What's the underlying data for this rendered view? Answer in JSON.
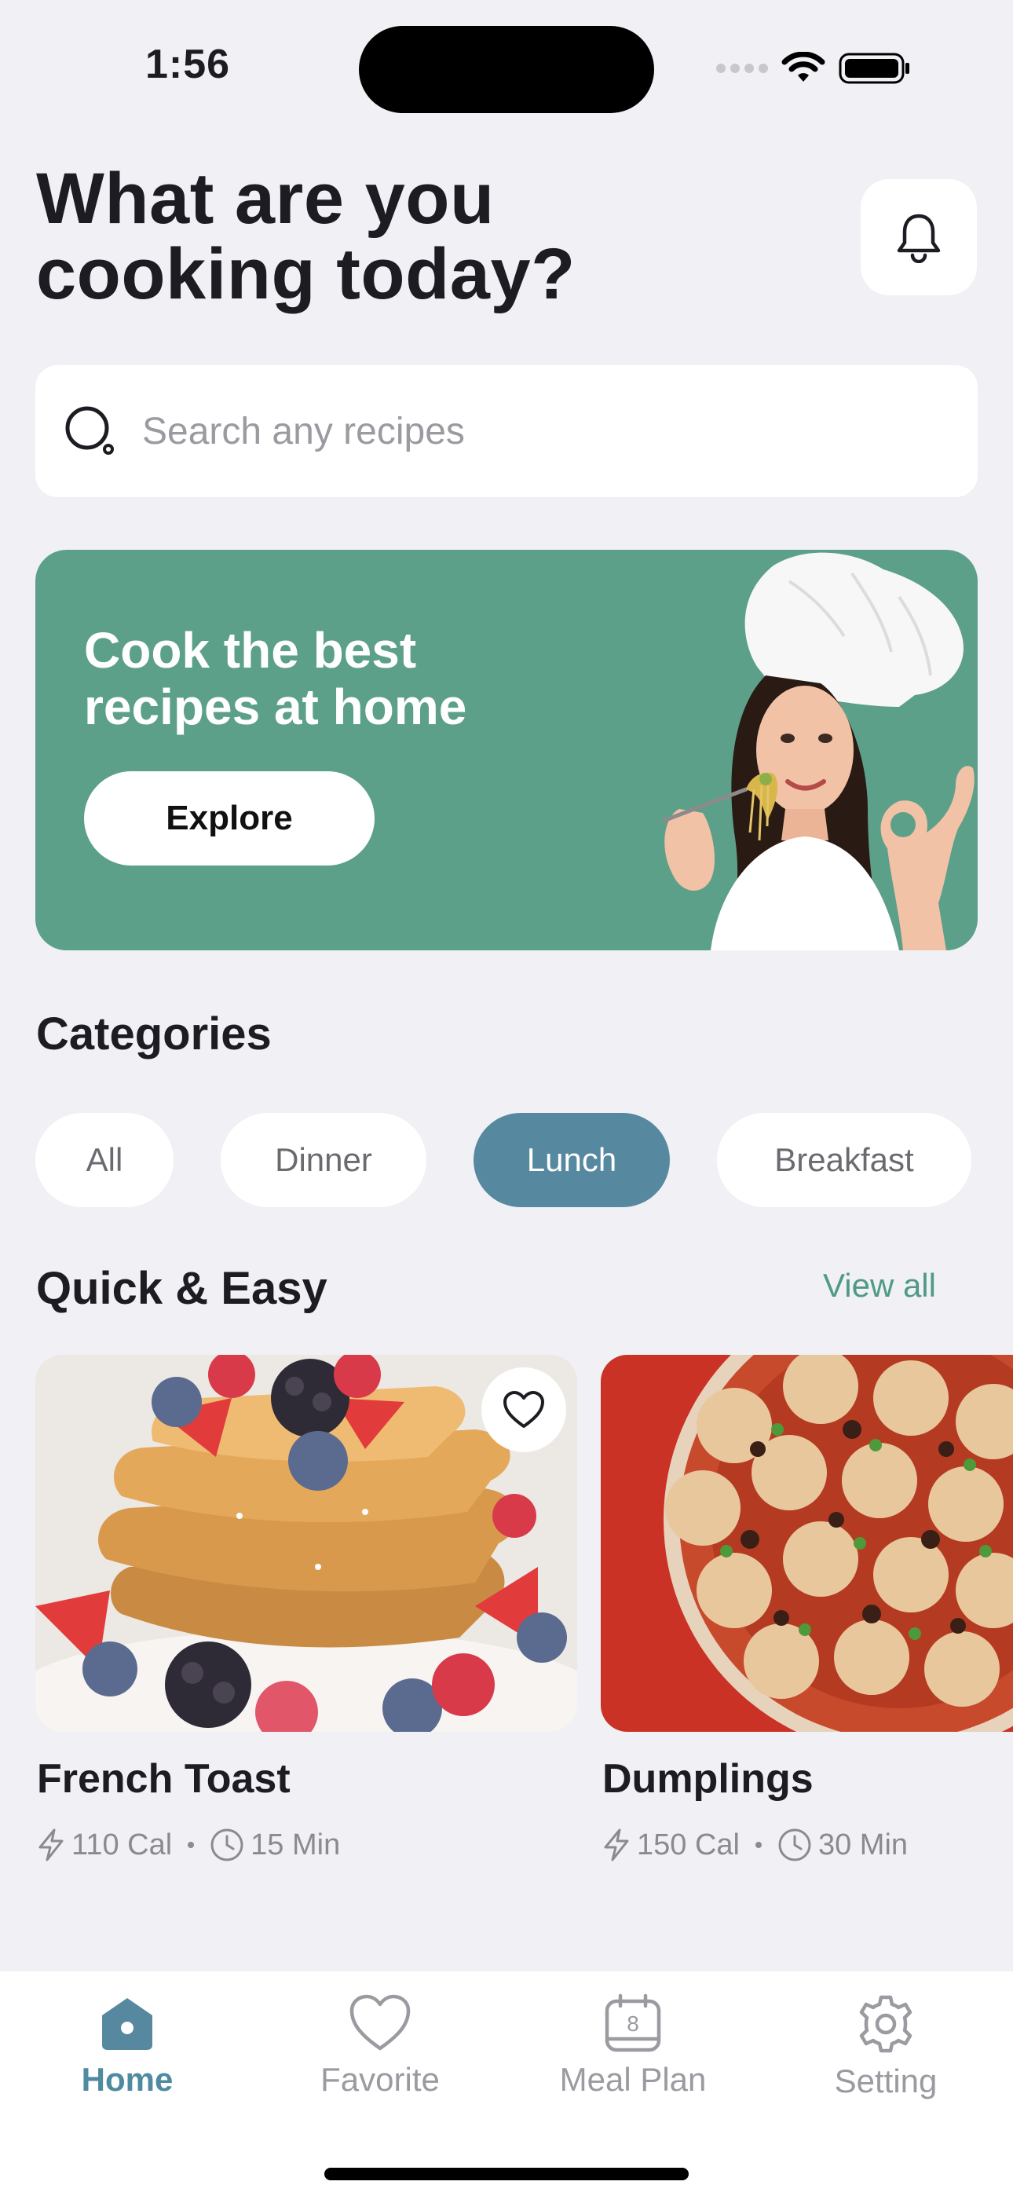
{
  "status_bar": {
    "time": "1:56"
  },
  "header": {
    "title_line1": "What are you",
    "title_line2": "cooking today?"
  },
  "search": {
    "placeholder": "Search any recipes",
    "value": ""
  },
  "banner": {
    "title_line1": "Cook the best",
    "title_line2": "recipes at home",
    "button_label": "Explore"
  },
  "categories": {
    "title": "Categories",
    "items": [
      {
        "label": "All",
        "active": false
      },
      {
        "label": "Dinner",
        "active": false
      },
      {
        "label": "Lunch",
        "active": true
      },
      {
        "label": "Breakfast",
        "active": false
      }
    ]
  },
  "quick_easy": {
    "title": "Quick & Easy",
    "view_all_label": "View all",
    "recipes": [
      {
        "name": "French Toast",
        "calories": "110 Cal",
        "time": "15 Min",
        "icon": "heart-icon"
      },
      {
        "name": "Dumplings",
        "calories": "150 Cal",
        "time": "30 Min"
      }
    ]
  },
  "bottom_nav": {
    "items": [
      {
        "label": "Home",
        "icon": "home-icon",
        "active": true
      },
      {
        "label": "Favorite",
        "icon": "heart-icon",
        "active": false
      },
      {
        "label": "Meal Plan",
        "icon": "calendar-icon",
        "active": false,
        "badge": "8"
      },
      {
        "label": "Setting",
        "icon": "gear-icon",
        "active": false
      }
    ]
  },
  "colors": {
    "accent": "#56899f",
    "banner": "#5da08a",
    "link": "#4f9a86",
    "background": "#f0f0f5"
  }
}
